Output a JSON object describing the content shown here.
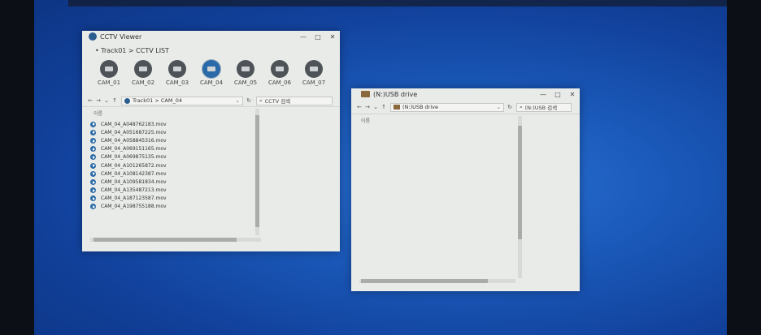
{
  "cctv_window": {
    "title": "CCTV Viewer",
    "controls": [
      "—",
      "□",
      "✕"
    ],
    "breadcrumb": "• Track01 > CCTV LIST",
    "cameras": [
      "CAM_01",
      "CAM_02",
      "CAM_03",
      "CAM_04",
      "CAM_05",
      "CAM_06",
      "CAM_07"
    ],
    "selected_camera": "CAM_04",
    "nav": [
      "←",
      "→",
      "⌄",
      "↑"
    ],
    "address": "Track01 > CAM_04",
    "search_placeholder": "CCTV 검색",
    "column_header": "이름",
    "files": [
      "CAM_04_A048762183.mov",
      "CAM_04_A051687225.mov",
      "CAM_04_A058845316.mov",
      "CAM_04_A069151165.mov",
      "CAM_04_A069875135.mov",
      "CAM_04_A101265872.mov",
      "CAM_04_A108142387.mov",
      "CAM_04_A109581834.mov",
      "CAM_04_A135487213.mov",
      "CAM_04_A187123587.mov",
      "CAM_04_A198755188.mov"
    ]
  },
  "usb_window": {
    "title": "(N:)USB drive",
    "controls": [
      "—",
      "□",
      "✕"
    ],
    "nav": [
      "←",
      "→",
      "⌄",
      "↑"
    ],
    "address": "(N:)USB drive",
    "search_placeholder": "(N:)USB 검색",
    "column_header": "이름"
  },
  "icons": {
    "back": "back-arrow-icon",
    "forward": "forward-arrow-icon",
    "up": "up-arrow-icon",
    "refresh": "refresh-icon",
    "search": "search-icon",
    "play": "play-icon",
    "camera": "camera-icon"
  },
  "colors": {
    "desktop": "#1a58b8",
    "window_bg": "#e9ebe8",
    "accent": "#2a6aa8",
    "camera_off": "#4e5358"
  }
}
